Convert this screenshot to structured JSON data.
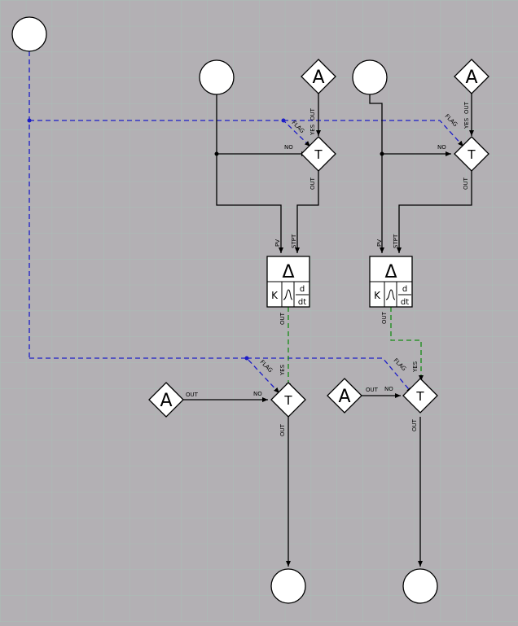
{
  "colors": {
    "background": "#b3b0b4",
    "grid": "#a9bfb6",
    "wire": "#000000",
    "flag_wire": "#1c1cc8",
    "deriv_wire": "#148c14",
    "block_fill": "#ffffff"
  },
  "blocks": {
    "analog_symbol": "A",
    "transfer_symbol": "T",
    "pid_delta": "Δ",
    "pid_gain": "K",
    "pid_derivative_num": "d",
    "pid_derivative_den": "dt"
  },
  "pins": {
    "out": "OUT",
    "yes": "YES",
    "no": "NO",
    "flag": "FLAG",
    "pv": "PV",
    "stpt": "STPT"
  }
}
